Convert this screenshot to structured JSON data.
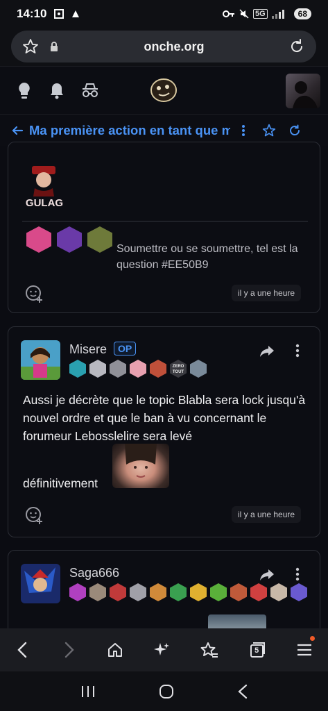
{
  "status": {
    "time": "14:10",
    "network": "5G",
    "battery": "68"
  },
  "browser": {
    "url": "onche.org",
    "tabs_count": "5"
  },
  "topic": {
    "title": "Ma première action en tant que m"
  },
  "posts": [
    {
      "signature": "Soumettre ou se soumettre, tel est la question #EE50B9",
      "gulag_text": "GULAG",
      "time": "il y a une heure"
    },
    {
      "username": "Misere",
      "op": "OP",
      "body": "Aussi je décrète que le topic Blabla sera lock jusqu'à nouvel ordre et que le ban à vu concernant le forumeur Lebosslelire sera levé",
      "body_last": "définitivement",
      "time": "il y a une heure",
      "badge_text": "ZERO TOUT"
    },
    {
      "username": "Saga666"
    }
  ],
  "colors": {
    "accent": "#4a93f5",
    "background": "#0b0c12",
    "card_border": "#2c2e36"
  }
}
